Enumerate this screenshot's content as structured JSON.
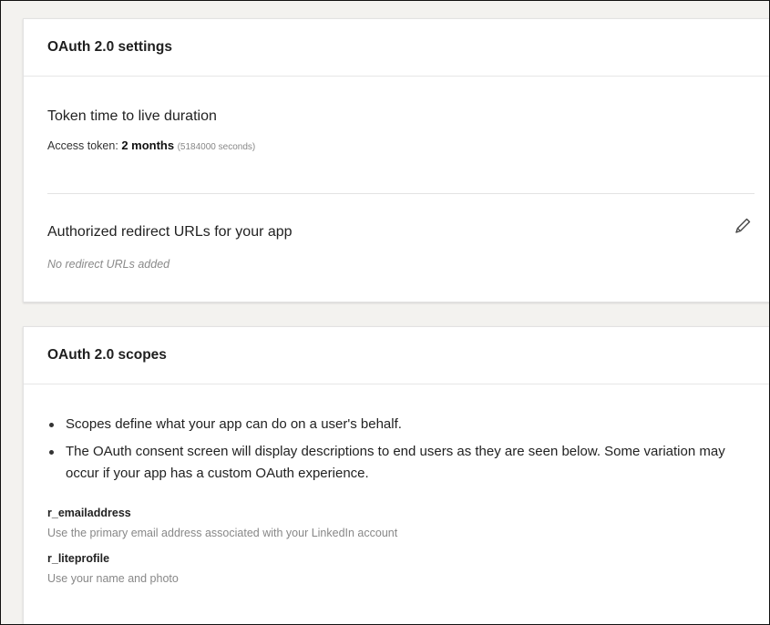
{
  "oauth_settings": {
    "title": "OAuth 2.0 settings",
    "token_section": {
      "heading": "Token time to live duration",
      "access_label": "Access token:",
      "access_value": "2 months",
      "access_seconds": "(5184000 seconds)"
    },
    "redirect_section": {
      "heading": "Authorized redirect URLs for your app",
      "empty_text": "No redirect URLs added",
      "edit_icon": "pencil-icon"
    }
  },
  "oauth_scopes": {
    "title": "OAuth 2.0 scopes",
    "bullets": [
      "Scopes define what your app can do on a user's behalf.",
      "The OAuth consent screen will display descriptions to end users as they are seen below. Some variation may occur if your app has a custom OAuth experience."
    ],
    "scopes": [
      {
        "name": "r_emailaddress",
        "description": "Use the primary email address associated with your LinkedIn account"
      },
      {
        "name": "r_liteprofile",
        "description": "Use your name and photo"
      }
    ]
  }
}
